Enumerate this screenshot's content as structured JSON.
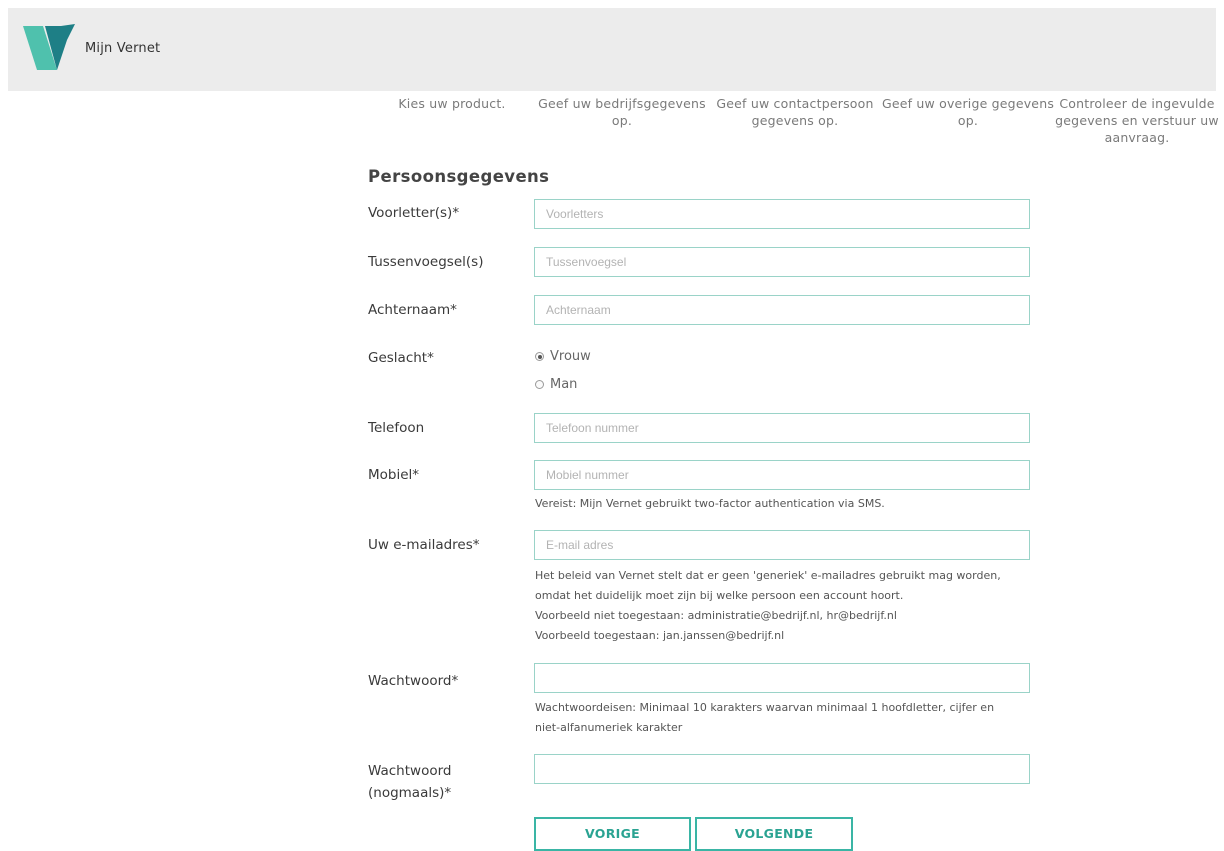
{
  "header": {
    "brand": "Mijn Vernet"
  },
  "steps": [
    "Kies uw product.",
    "Geef uw bedrijfsgegevens op.",
    "Geef uw contactpersoon gegevens op.",
    "Geef uw overige gegevens op.",
    "Controleer de ingevulde gegevens en verstuur uw aanvraag."
  ],
  "form": {
    "title": "Persoonsgegevens",
    "voorletters": {
      "label": "Voorletter(s)*",
      "placeholder": "Voorletters",
      "value": ""
    },
    "tussenvoegsel": {
      "label": "Tussenvoegsel(s)",
      "placeholder": "Tussenvoegsel",
      "value": ""
    },
    "achternaam": {
      "label": "Achternaam*",
      "placeholder": "Achternaam",
      "value": ""
    },
    "geslacht": {
      "label": "Geslacht*",
      "options": [
        "Vrouw",
        "Man"
      ],
      "selected": "Vrouw"
    },
    "telefoon": {
      "label": "Telefoon",
      "placeholder": "Telefoon nummer",
      "value": ""
    },
    "mobiel": {
      "label": "Mobiel*",
      "placeholder": "Mobiel nummer",
      "value": "",
      "help": "Vereist: Mijn Vernet gebruikt two-factor authentication via SMS."
    },
    "email": {
      "label": "Uw e-mailadres*",
      "placeholder": "E-mail adres",
      "value": "",
      "help": [
        "Het beleid van Vernet stelt dat er geen 'generiek' e-mailadres gebruikt mag worden,",
        "omdat het duidelijk moet zijn bij welke persoon een account hoort.",
        "Voorbeeld niet toegestaan: administratie@bedrijf.nl, hr@bedrijf.nl",
        "Voorbeeld toegestaan: jan.janssen@bedrijf.nl"
      ]
    },
    "wachtwoord": {
      "label": "Wachtwoord*",
      "value": "",
      "help": [
        "Wachtwoordeisen: Minimaal 10 karakters waarvan minimaal 1 hoofdletter, cijfer en",
        "niet-alfanumeriek karakter"
      ]
    },
    "wachtwoord2": {
      "label_line1": "Wachtwoord",
      "label_line2": "(nogmaals)*",
      "value": ""
    }
  },
  "buttons": {
    "prev": "VORIGE",
    "next": "VOLGENDE"
  },
  "colors": {
    "accent": "#3ab5a5",
    "input_border": "#9ad3c8",
    "header_bg": "#ececec"
  }
}
